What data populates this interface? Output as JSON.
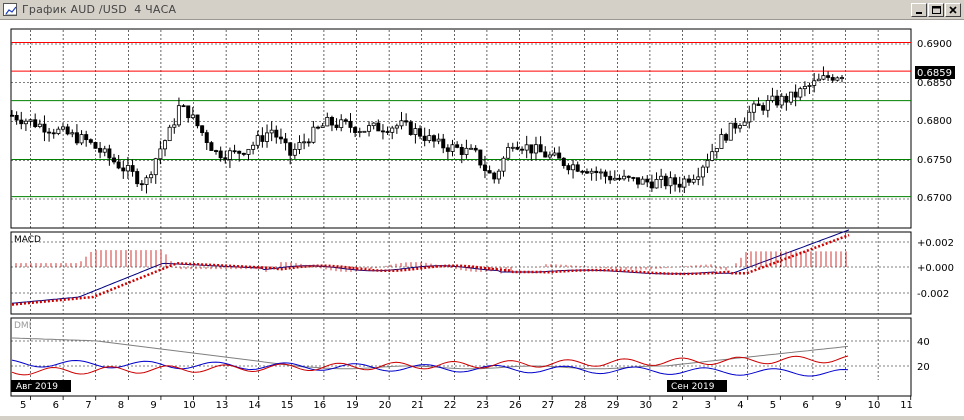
{
  "window": {
    "title": "График AUD /USD  4 ЧАСА",
    "buttons": [
      "minimize",
      "maximize",
      "close"
    ]
  },
  "colors": {
    "frame_bg": "#d4d0c8",
    "chart_bg": "#ffffff",
    "grid": "#000000",
    "price_line": "#ff0000",
    "level_line": "#008000",
    "macd_line": "#000080",
    "macd_signal": "#cc0000",
    "dmi_plus": "#0000cc",
    "dmi_minus": "#cc0000",
    "adx": "#808080"
  },
  "icons": {
    "app": "chart-icon",
    "minimize": "minimize-icon",
    "maximize": "maximize-icon",
    "close": "close-icon"
  },
  "price_panel": {
    "current_price": "0.6859",
    "y_labels": [
      "0.6900",
      "0.6850",
      "0.6800",
      "0.6750",
      "0.6700"
    ],
    "resistance_levels": [
      0.6902,
      0.6865
    ],
    "support_levels": [
      0.6827,
      0.6751,
      0.6703
    ]
  },
  "macd_panel": {
    "title": "MACD",
    "y_labels": [
      "+0.002",
      "+0.000",
      "-0.002"
    ]
  },
  "dmi_panel": {
    "title": "DMI",
    "y_labels": [
      "40",
      "20"
    ]
  },
  "time_axis": {
    "tags": [
      "Авг 2019",
      "Сен 2019"
    ],
    "day_labels": [
      "5",
      "6",
      "7",
      "8",
      "9",
      "10",
      "13",
      "14",
      "15",
      "16",
      "19",
      "20",
      "21",
      "22",
      "23",
      "26",
      "27",
      "28",
      "29",
      "30",
      "2",
      "3",
      "4",
      "5",
      "6",
      "9",
      "10",
      "11"
    ]
  },
  "chart_data": {
    "type": "candlestick",
    "symbol": "AUD/USD",
    "timeframe": "4 ЧАСА",
    "price_path": [
      [
        0,
        0.6808
      ],
      [
        4,
        0.6775
      ],
      [
        6,
        0.674
      ],
      [
        7.2,
        0.672
      ],
      [
        7.6,
        0.6745
      ],
      [
        8,
        0.6765
      ],
      [
        8.6,
        0.679
      ],
      [
        9,
        0.6818
      ],
      [
        9.5,
        0.6812
      ],
      [
        10,
        0.6795
      ],
      [
        11,
        0.676
      ],
      [
        12,
        0.6758
      ],
      [
        13,
        0.677
      ],
      [
        14,
        0.679
      ],
      [
        15,
        0.6757
      ],
      [
        16,
        0.678
      ],
      [
        17,
        0.6798
      ],
      [
        18,
        0.6795
      ],
      [
        19,
        0.679
      ],
      [
        20,
        0.6793
      ],
      [
        21,
        0.6795
      ],
      [
        22,
        0.6785
      ],
      [
        23,
        0.677
      ],
      [
        24,
        0.6765
      ],
      [
        25,
        0.6758
      ],
      [
        25.5,
        0.674
      ],
      [
        26,
        0.6725
      ],
      [
        26.5,
        0.675
      ],
      [
        27,
        0.6775
      ],
      [
        28,
        0.6765
      ],
      [
        29,
        0.6755
      ],
      [
        30,
        0.6745
      ],
      [
        31,
        0.674
      ],
      [
        32,
        0.673
      ],
      [
        33,
        0.6725
      ],
      [
        34,
        0.6722
      ],
      [
        35,
        0.6722
      ],
      [
        36,
        0.672
      ],
      [
        37,
        0.6735
      ],
      [
        38,
        0.677
      ],
      [
        39,
        0.6795
      ],
      [
        40,
        0.6815
      ],
      [
        41,
        0.6825
      ],
      [
        42,
        0.683
      ],
      [
        43,
        0.6845
      ],
      [
        44,
        0.6857
      ],
      [
        44.8,
        0.6862
      ]
    ]
  }
}
